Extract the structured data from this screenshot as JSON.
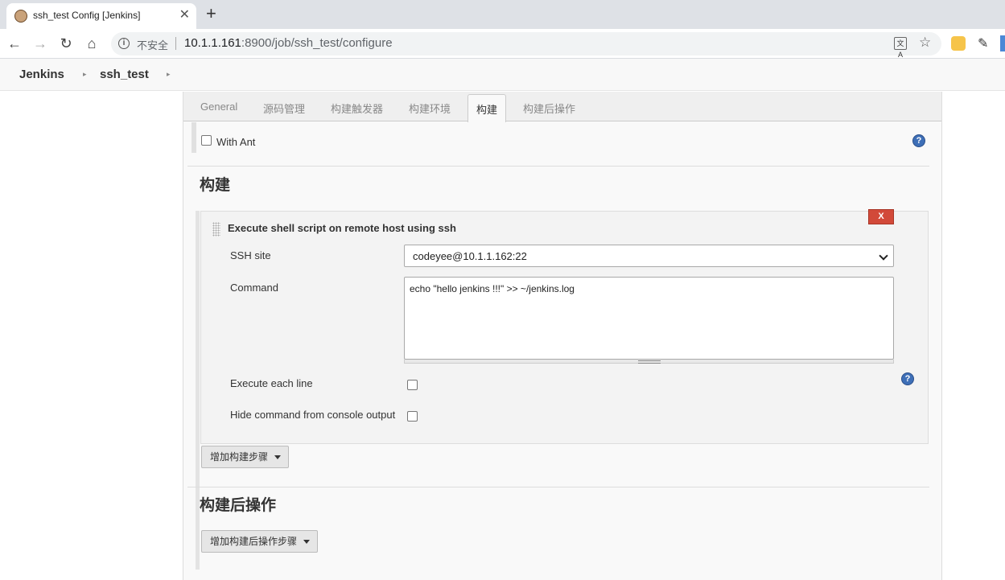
{
  "browser": {
    "tab_title": "ssh_test Config [Jenkins]",
    "close_glyph": "✕",
    "new_tab_glyph": "+",
    "insecure_label": "不安全",
    "url_host": "10.1.1.161",
    "url_rest": ":8900/job/ssh_test/configure",
    "translate_glyph": "文A"
  },
  "breadcrumb": {
    "items": [
      "Jenkins",
      "ssh_test"
    ]
  },
  "config_tabs": [
    {
      "label": "General",
      "active": false
    },
    {
      "label": "源码管理",
      "active": false
    },
    {
      "label": "构建触发器",
      "active": false
    },
    {
      "label": "构建环境",
      "active": false
    },
    {
      "label": "构建",
      "active": true
    },
    {
      "label": "构建后操作",
      "active": false
    }
  ],
  "build_env": {
    "with_ant_label": "With Ant",
    "with_ant_checked": false
  },
  "build": {
    "title": "构建",
    "step": {
      "title": "Execute shell script on remote host using ssh",
      "delete_label": "X",
      "ssh_site_label": "SSH site",
      "ssh_site_value": "codeyee@10.1.1.162:22",
      "command_label": "Command",
      "command_value": "echo \"hello jenkins !!!\" >> ~/jenkins.log",
      "execute_each_line_label": "Execute each line",
      "execute_each_line_checked": false,
      "hide_command_label": "Hide command from console output",
      "hide_command_checked": false
    },
    "add_step_label": "增加构建步骤"
  },
  "post_build": {
    "title": "构建后操作",
    "add_step_label": "增加构建后操作步骤"
  },
  "help_glyph": "?",
  "colors": {
    "delete_button": "#d24939",
    "help_icon": "#3e6fb7"
  }
}
